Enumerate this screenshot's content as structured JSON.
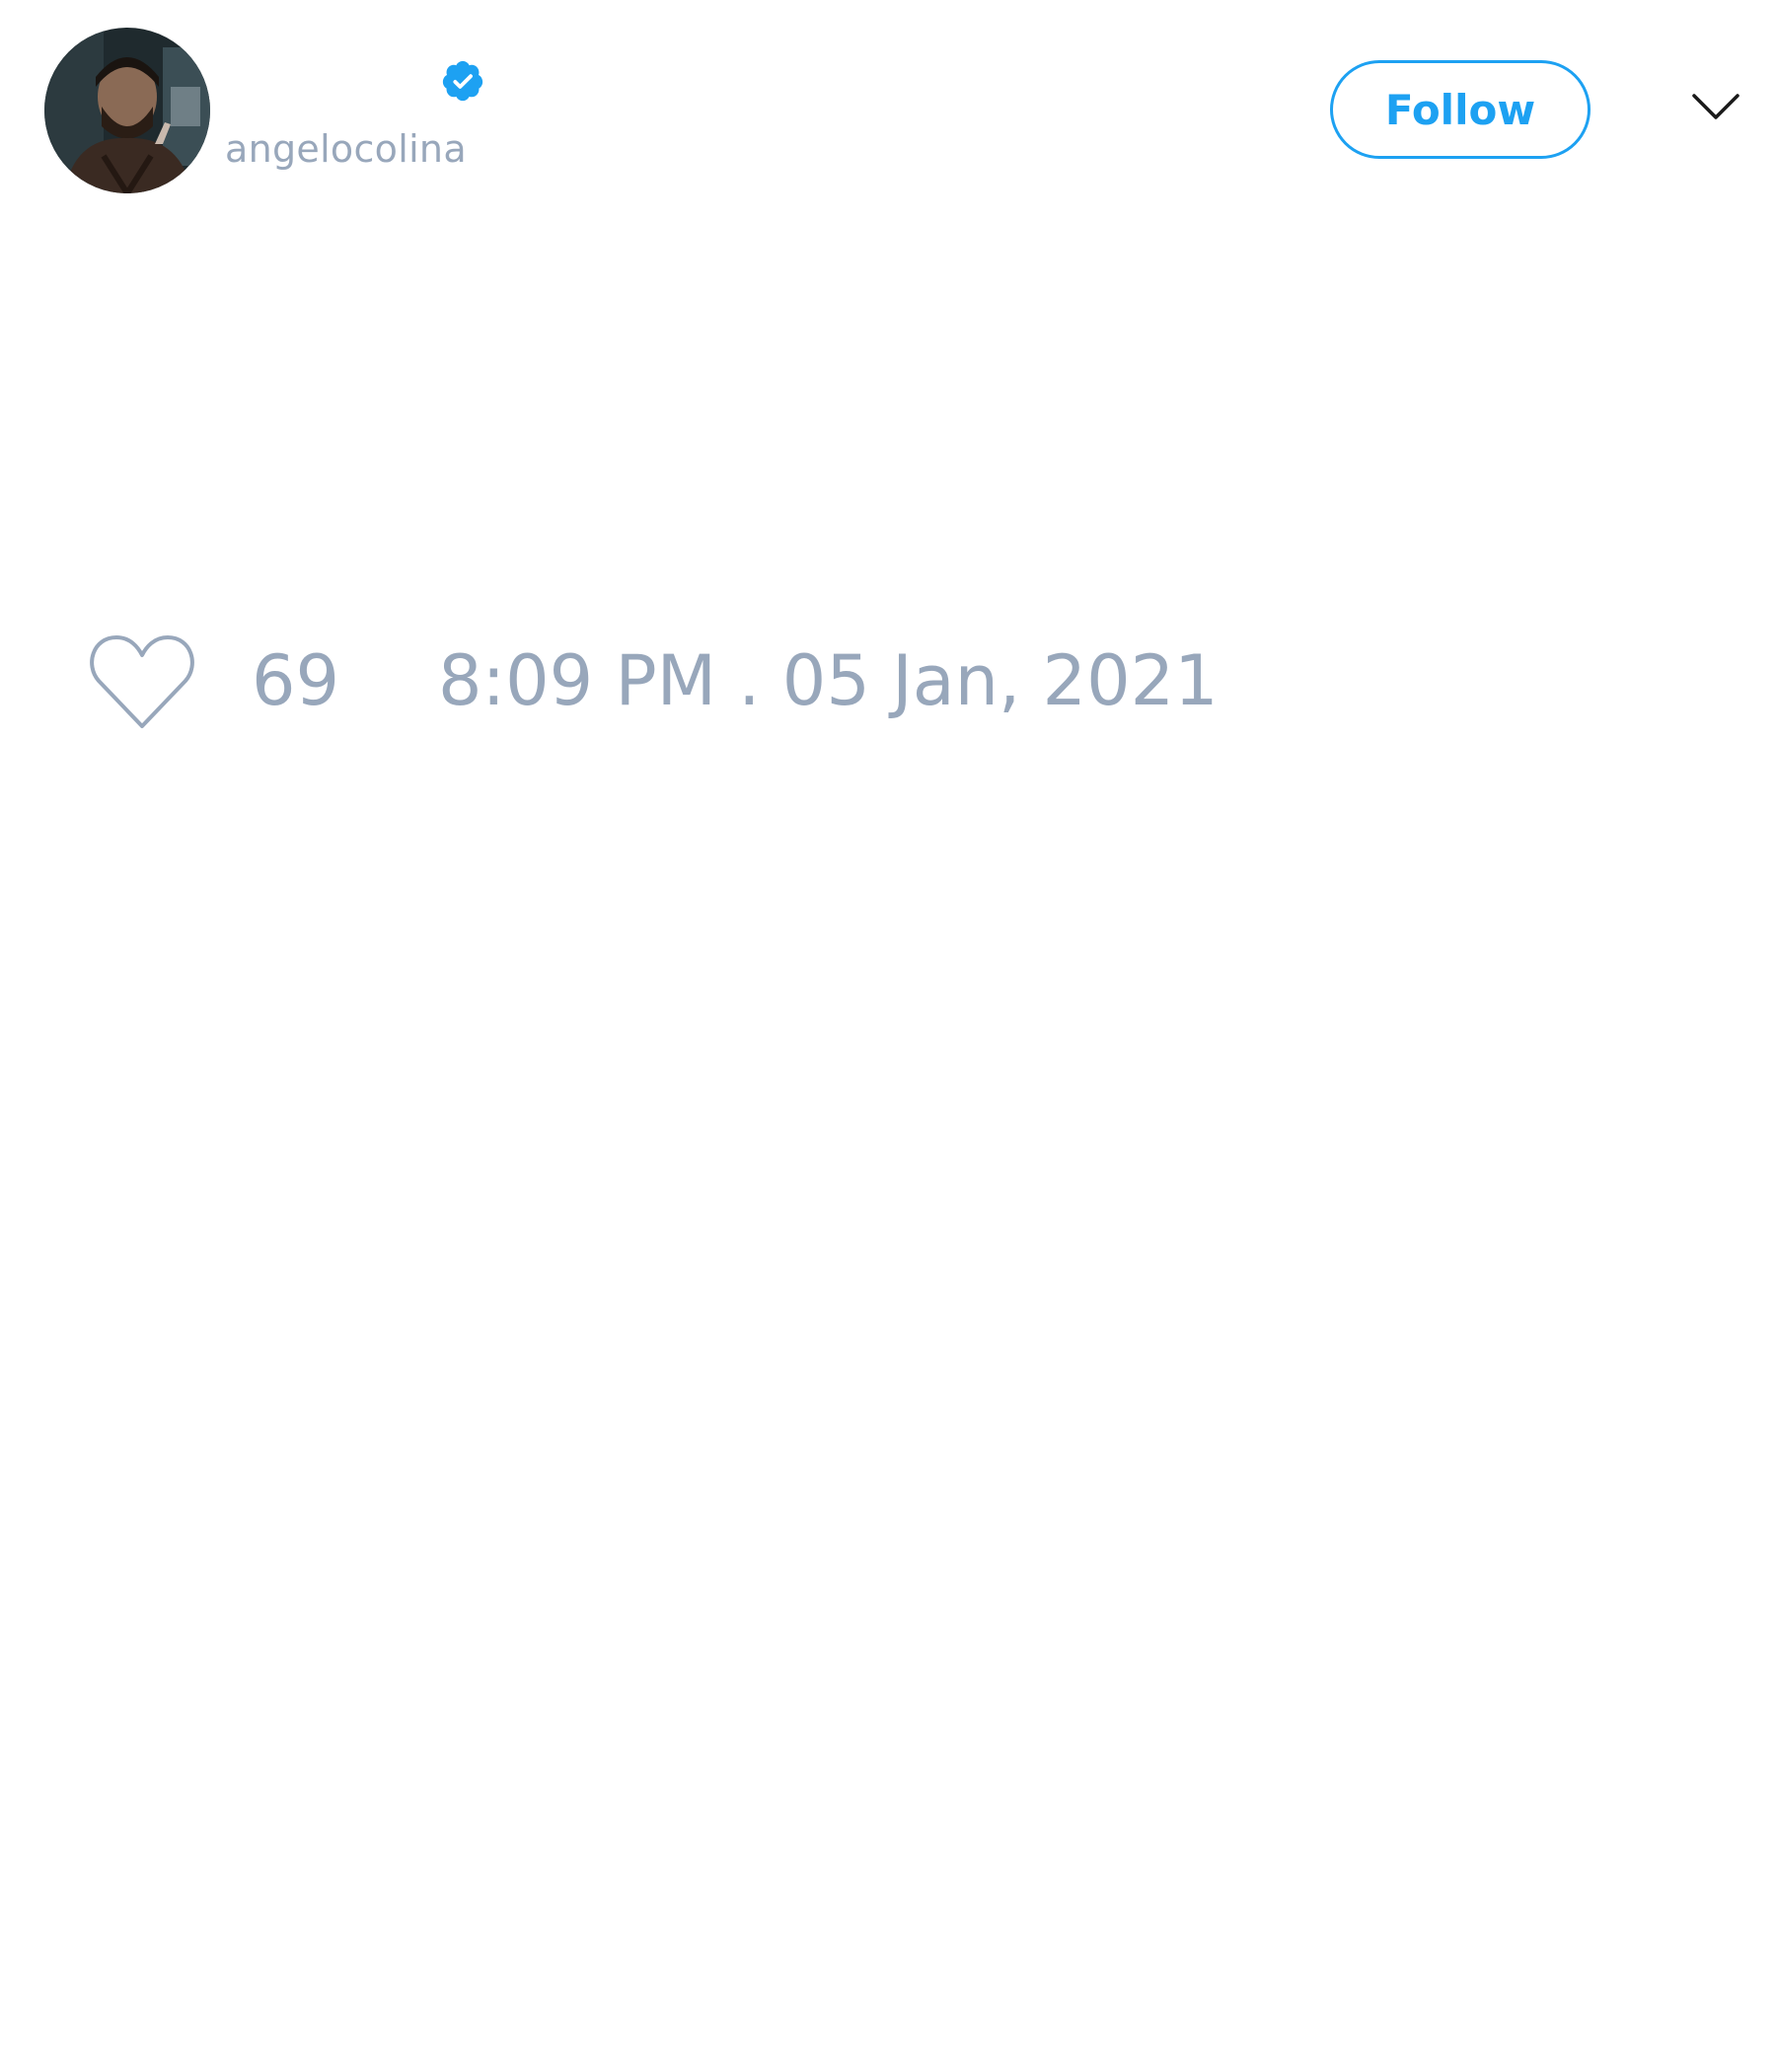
{
  "tweet": {
    "author": {
      "handle": "angelocolina",
      "verified": true,
      "avatar_icon": "user-avatar-photo"
    },
    "actions": {
      "follow_label": "Follow",
      "menu_icon": "chevron-down-icon"
    },
    "stats": {
      "like_icon": "heart-outline-icon",
      "like_count": "69",
      "timestamp": "8:09 PM . 05 Jan, 2021"
    }
  },
  "colors": {
    "accent": "#1da1f2",
    "muted_text": "#98a7bb",
    "icon_stroke": "#98a7bb",
    "caret": "#1a1a1a",
    "background": "#ffffff"
  }
}
